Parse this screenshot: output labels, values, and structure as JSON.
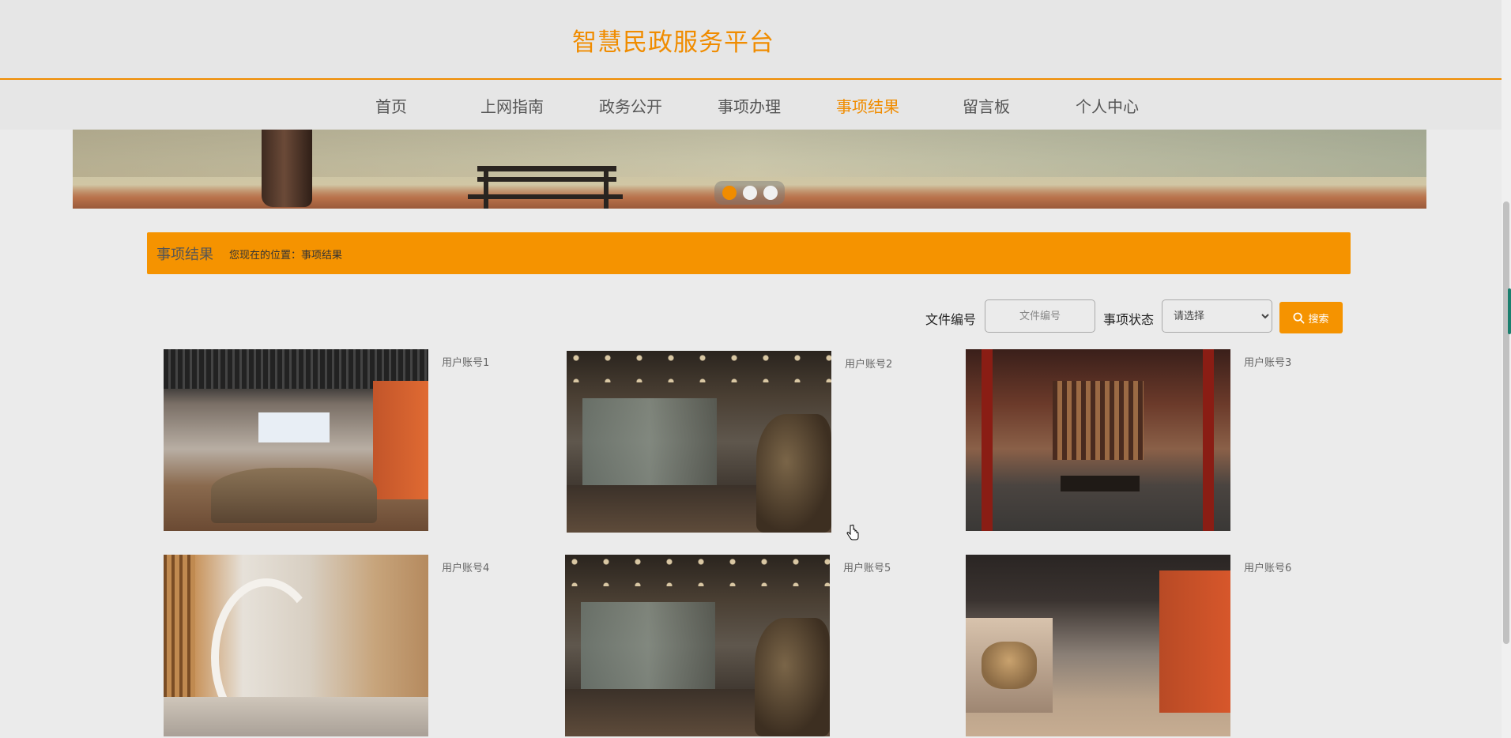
{
  "header": {
    "site_title": "智慧民政服务平台"
  },
  "nav": {
    "items": [
      {
        "label": "首页",
        "active": false
      },
      {
        "label": "上网指南",
        "active": false
      },
      {
        "label": "政务公开",
        "active": false
      },
      {
        "label": "事项办理",
        "active": false
      },
      {
        "label": "事项结果",
        "active": true
      },
      {
        "label": "留言板",
        "active": false
      },
      {
        "label": "个人中心",
        "active": false
      }
    ]
  },
  "carousel": {
    "slide_count": 3,
    "active_index": 0
  },
  "breadcrumb": {
    "title": "事项结果",
    "location": "您现在的位置：事项结果"
  },
  "search": {
    "file_no_label": "文件编号",
    "file_no_placeholder": "文件编号",
    "file_no_value": "",
    "status_label": "事项状态",
    "status_selected": "请选择",
    "button_label": "搜索"
  },
  "results": [
    {
      "account": "用户账号1",
      "image": "exhibition-hall-orange-wall"
    },
    {
      "account": "用户账号2",
      "image": "museum-gallery-pottery"
    },
    {
      "account": "用户账号3",
      "image": "red-pillar-hall"
    },
    {
      "account": "用户账号4",
      "image": "spiral-stair-wood-hall"
    },
    {
      "account": "用户账号5",
      "image": "museum-gallery-pottery"
    },
    {
      "account": "用户账号6",
      "image": "gallery-horse-statue"
    }
  ],
  "colors": {
    "accent": "#f59300",
    "title": "#f08c00",
    "background": "#ebebeb"
  }
}
